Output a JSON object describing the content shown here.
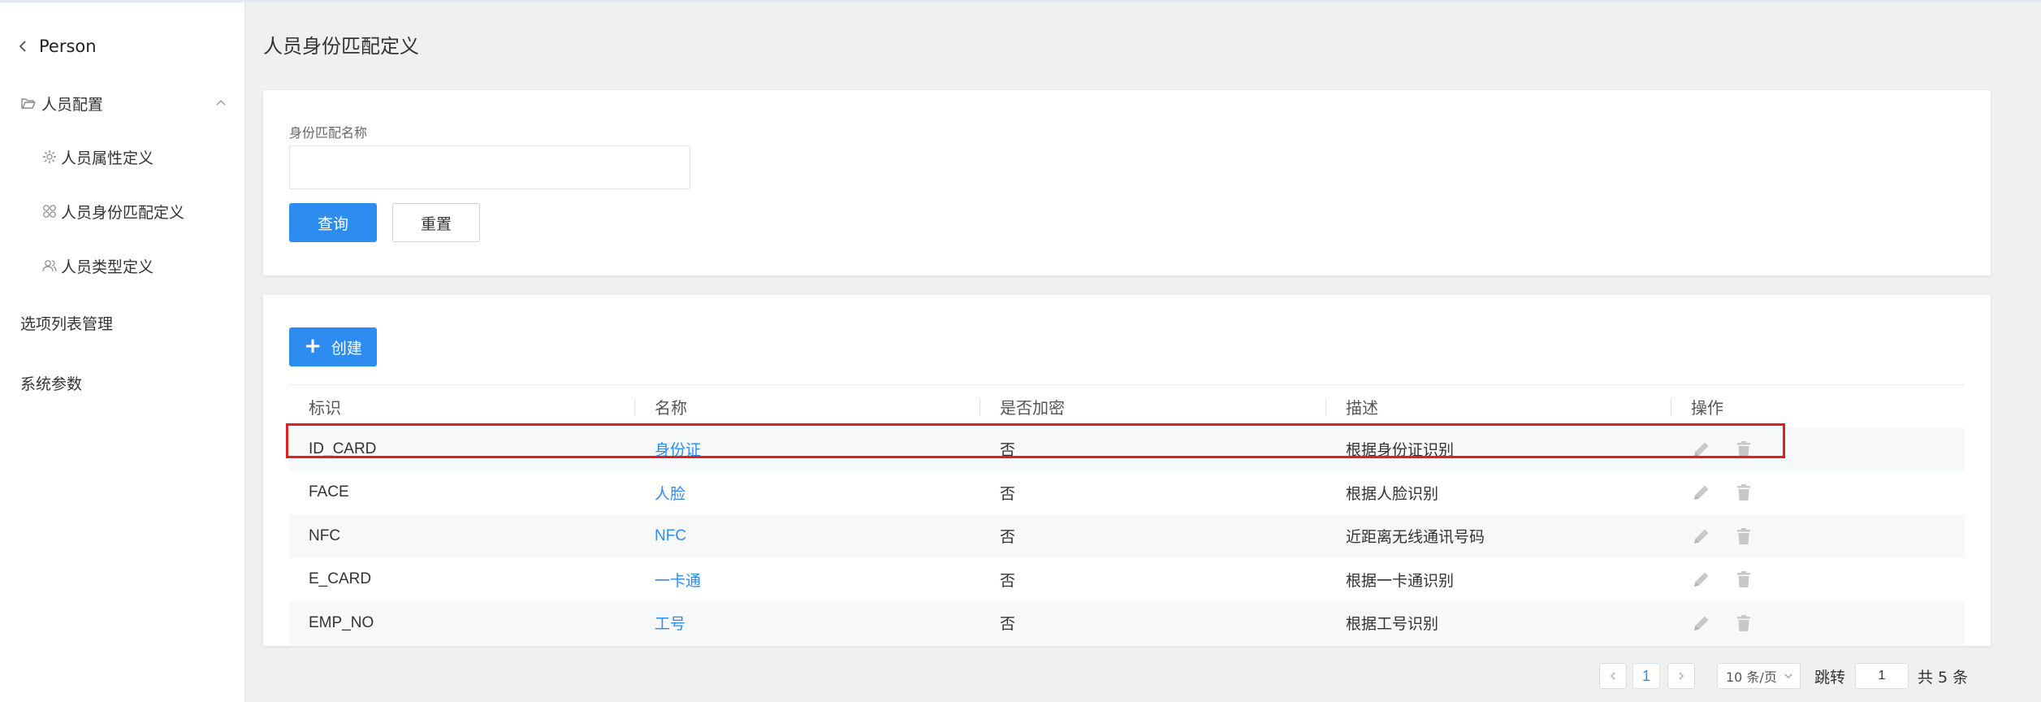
{
  "sidebar": {
    "back_label": "Person",
    "group_label": "人员配置",
    "sub_items": [
      "人员属性定义",
      "人员身份匹配定义",
      "人员类型定义"
    ],
    "items": [
      "选项列表管理",
      "系统参数"
    ]
  },
  "page": {
    "title": "人员身份匹配定义"
  },
  "filter": {
    "label": "身份匹配名称",
    "value": "",
    "placeholder": "",
    "query_label": "查询",
    "reset_label": "重置"
  },
  "table": {
    "create_label": "创建",
    "headers": [
      "标识",
      "名称",
      "是否加密",
      "描述",
      "操作"
    ],
    "rows": [
      {
        "id": "ID_CARD",
        "name": "身份证",
        "encrypted": "否",
        "desc": "根据身份证识别"
      },
      {
        "id": "FACE",
        "name": "人脸",
        "encrypted": "否",
        "desc": "根据人脸识别"
      },
      {
        "id": "NFC",
        "name": "NFC",
        "encrypted": "否",
        "desc": "近距离无线通讯号码"
      },
      {
        "id": "E_CARD",
        "name": "一卡通",
        "encrypted": "否",
        "desc": "根据一卡通识别"
      },
      {
        "id": "EMP_NO",
        "name": "工号",
        "encrypted": "否",
        "desc": "根据工号识别"
      }
    ]
  },
  "pagination": {
    "current_page": "1",
    "page_size": "10 条/页",
    "jump_label": "跳转",
    "jump_value": "1",
    "total": "共 5 条"
  },
  "colors": {
    "primary": "#2d8cf0",
    "highlight": "#e02020",
    "icon_gray": "#c8c8c8"
  }
}
